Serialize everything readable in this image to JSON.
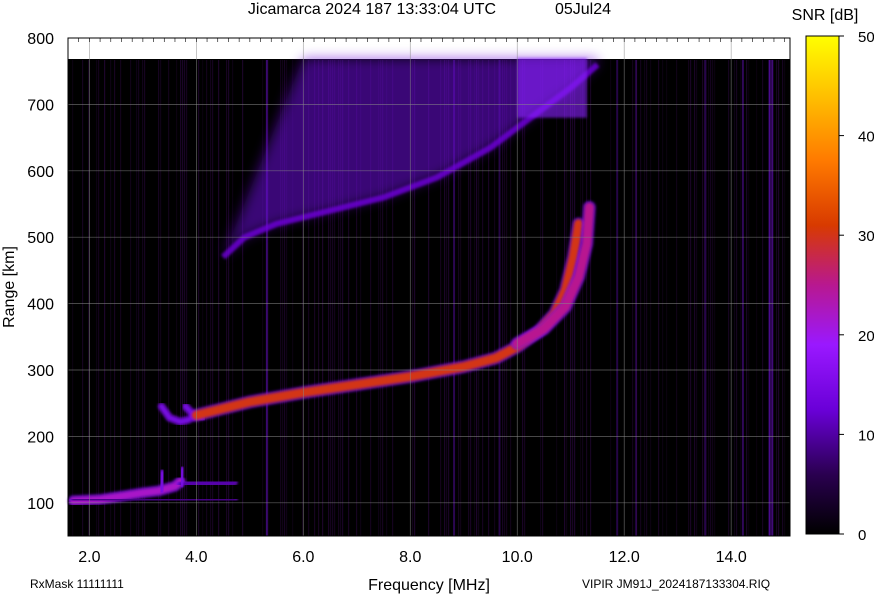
{
  "chart_data": {
    "type": "heatmap",
    "title": "Jicamarca 2024 187 13:33:04 UTC",
    "date_label": "05Jul24",
    "xlabel": "Frequency [MHz]",
    "ylabel": "Range [km]",
    "xlim": [
      1.6,
      15.1
    ],
    "ylim": [
      50,
      800
    ],
    "x_ticks": [
      "2.0",
      "4.0",
      "6.0",
      "8.0",
      "10.0",
      "12.0",
      "14.0"
    ],
    "y_ticks": [
      "100",
      "200",
      "300",
      "400",
      "500",
      "600",
      "700",
      "800"
    ],
    "colorbar": {
      "label": "SNR [dB]",
      "range": [
        0,
        50
      ],
      "ticks": [
        "0",
        "10",
        "20",
        "30",
        "40",
        "50"
      ]
    },
    "grid": true,
    "footer_left": "RxMask 11111111",
    "footer_right": "VIPIR  JM91J_2024187133304.RIQ",
    "traces": [
      {
        "name_hidden": true,
        "layer": "E",
        "snr": 22,
        "points": [
          [
            1.7,
            103
          ],
          [
            2.2,
            105
          ],
          [
            2.6,
            110
          ],
          [
            3.0,
            115
          ],
          [
            3.3,
            118
          ],
          [
            3.6,
            125
          ],
          [
            3.7,
            132
          ]
        ]
      },
      {
        "layer": "E-faint",
        "snr": 10,
        "points": [
          [
            3.7,
            128
          ],
          [
            4.2,
            130
          ],
          [
            4.7,
            131
          ]
        ]
      },
      {
        "layer": "E-faint",
        "snr": 8,
        "points": [
          [
            1.7,
            104
          ],
          [
            3.0,
            105
          ],
          [
            4.7,
            105
          ]
        ]
      },
      {
        "layer": "E-cusp",
        "snr": 14,
        "points": [
          [
            3.34,
            120
          ],
          [
            3.37,
            145
          ]
        ]
      },
      {
        "layer": "E-cusp",
        "snr": 14,
        "points": [
          [
            3.72,
            128
          ],
          [
            3.75,
            150
          ]
        ]
      },
      {
        "layer": "F-cusp",
        "snr": 14,
        "points": [
          [
            3.35,
            245
          ],
          [
            3.5,
            228
          ],
          [
            3.7,
            222
          ],
          [
            3.85,
            225
          ],
          [
            4.0,
            232
          ]
        ]
      },
      {
        "layer": "F-cusp",
        "snr": 14,
        "points": [
          [
            3.8,
            245
          ],
          [
            3.95,
            232
          ],
          [
            4.1,
            228
          ]
        ]
      },
      {
        "layer": "F-O",
        "snr": 30,
        "points": [
          [
            4.0,
            232
          ],
          [
            4.5,
            242
          ],
          [
            5.0,
            252
          ],
          [
            6.0,
            266
          ],
          [
            7.0,
            278
          ],
          [
            8.0,
            290
          ],
          [
            9.0,
            305
          ],
          [
            9.6,
            318
          ],
          [
            10.0,
            335
          ],
          [
            10.4,
            358
          ],
          [
            10.7,
            385
          ],
          [
            10.9,
            420
          ],
          [
            11.05,
            470
          ],
          [
            11.15,
            520
          ]
        ]
      },
      {
        "layer": "F-X",
        "snr": 25,
        "points": [
          [
            10.0,
            340
          ],
          [
            10.5,
            362
          ],
          [
            10.9,
            395
          ],
          [
            11.15,
            440
          ],
          [
            11.3,
            490
          ],
          [
            11.35,
            545
          ]
        ]
      },
      {
        "layer": "spread-F",
        "snr": 13,
        "points": [
          [
            4.5,
            470
          ],
          [
            4.9,
            500
          ],
          [
            5.5,
            520
          ],
          [
            6.5,
            540
          ],
          [
            7.5,
            560
          ],
          [
            8.5,
            590
          ],
          [
            9.5,
            635
          ],
          [
            10.0,
            665
          ],
          [
            10.5,
            695
          ],
          [
            11.0,
            725
          ],
          [
            11.5,
            760
          ]
        ]
      }
    ]
  }
}
